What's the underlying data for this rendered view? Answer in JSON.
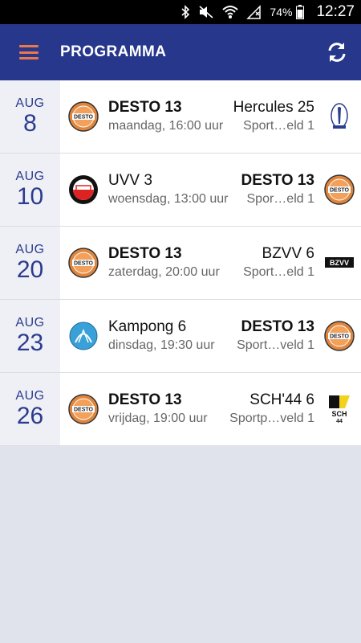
{
  "status_bar": {
    "battery": "74%",
    "time": "12:27"
  },
  "app_bar": {
    "title": "PROGRAMMA"
  },
  "matches": [
    {
      "month": "AUG",
      "day": "8",
      "home": "DESTO 13",
      "away": "Hercules 25",
      "home_bold": true,
      "away_bold": false,
      "when": "maandag, 16:00 uur",
      "venue": "Sport…eld 1",
      "home_logo": "desto-logo",
      "away_logo": "hercules-logo"
    },
    {
      "month": "AUG",
      "day": "10",
      "home": "UVV 3",
      "away": "DESTO 13",
      "home_bold": false,
      "away_bold": true,
      "when": "woensdag, 13:00 uur",
      "venue": "Spor…eld 1",
      "home_logo": "uvv-logo",
      "away_logo": "desto-logo"
    },
    {
      "month": "AUG",
      "day": "20",
      "home": "DESTO 13",
      "away": "BZVV 6",
      "home_bold": true,
      "away_bold": false,
      "when": "zaterdag, 20:00 uur",
      "venue": "Sport…eld 1",
      "home_logo": "desto-logo",
      "away_logo": "bzvv-logo"
    },
    {
      "month": "AUG",
      "day": "23",
      "home": "Kampong 6",
      "away": "DESTO 13",
      "home_bold": false,
      "away_bold": true,
      "when": "dinsdag, 19:30 uur",
      "venue": "Sport…veld 1",
      "home_logo": "kampong-logo",
      "away_logo": "desto-logo"
    },
    {
      "month": "AUG",
      "day": "26",
      "home": "DESTO 13",
      "away": "SCH'44 6",
      "home_bold": true,
      "away_bold": false,
      "when": "vrijdag, 19:00 uur",
      "venue": "Sportp…veld 1",
      "home_logo": "desto-logo",
      "away_logo": "sch44-logo"
    }
  ],
  "logo_text": {
    "desto": "DESTO",
    "bzvv": "BZVV",
    "sch_top": "SCH",
    "sch_bottom": "44"
  },
  "colors": {
    "app_bar": "#26378c",
    "accent": "#e9784a",
    "date_text": "#2c3b8f",
    "background": "#e1e3ec"
  }
}
